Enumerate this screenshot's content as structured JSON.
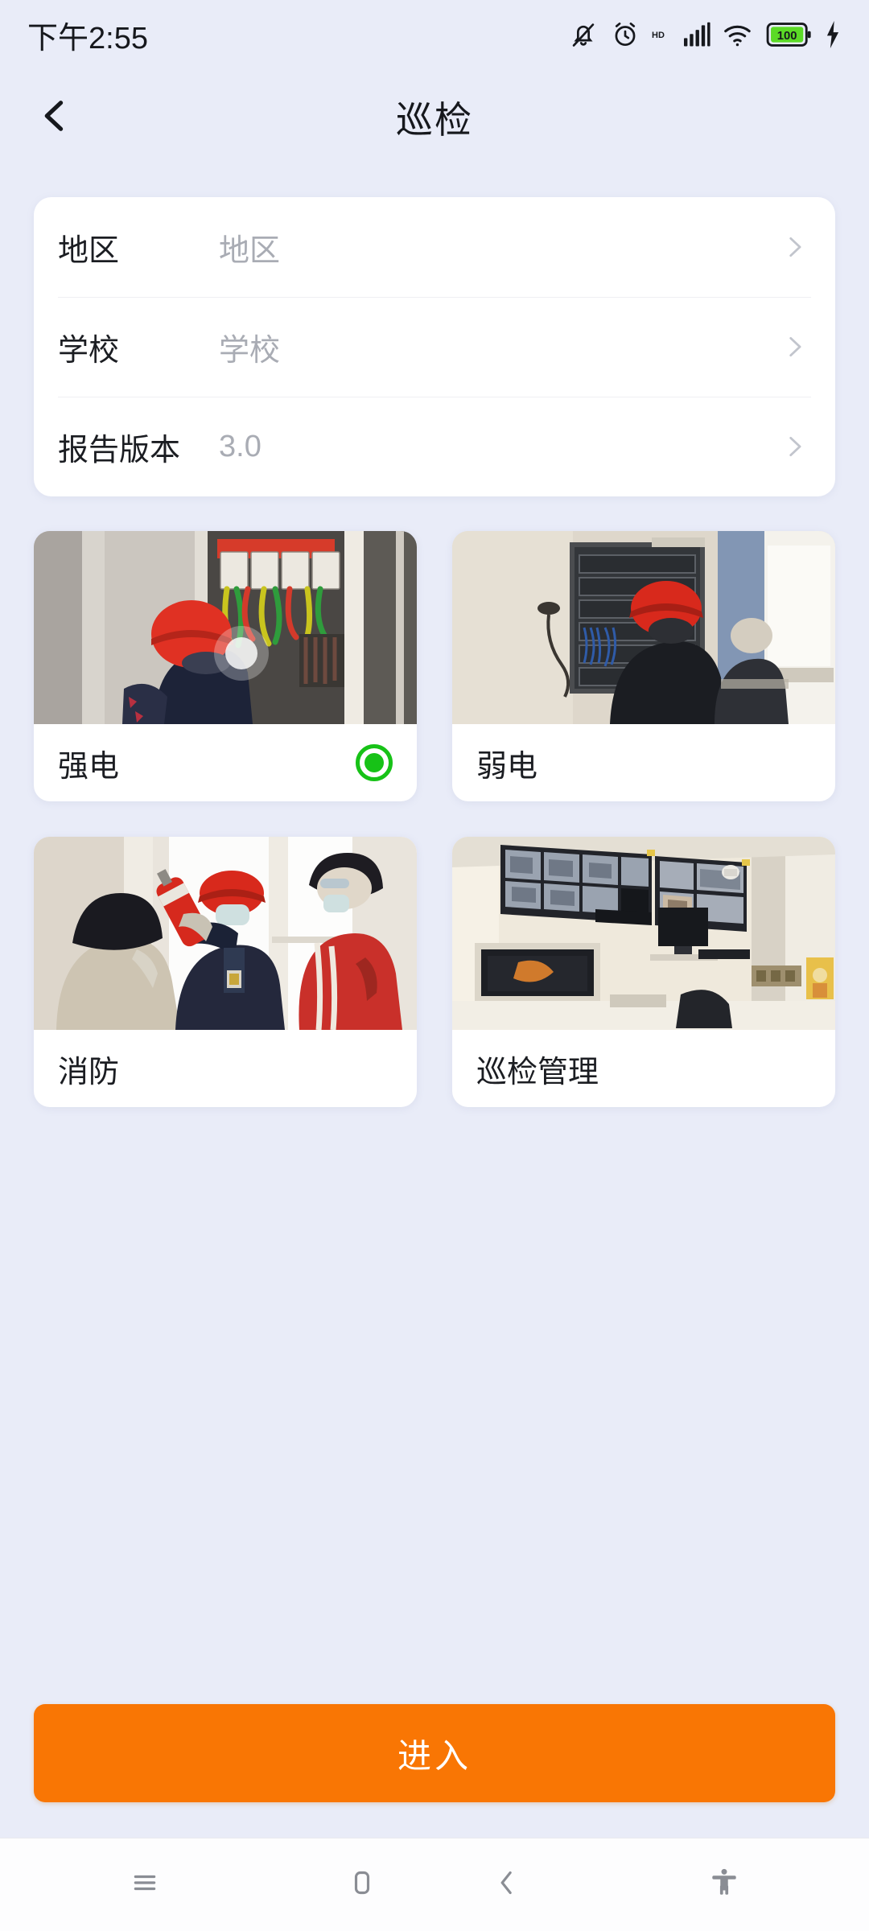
{
  "status_bar": {
    "time": "下午2:55",
    "battery_level": "100",
    "icons": [
      "bell-muted-icon",
      "alarm-icon",
      "hd-icon",
      "signal-icon",
      "wifi-icon",
      "battery-icon",
      "charging-bolt-icon"
    ]
  },
  "header": {
    "title": "巡检",
    "back_icon": "chevron-left-icon"
  },
  "form": {
    "rows": [
      {
        "label": "地区",
        "value": "地区",
        "is_placeholder": true,
        "chevron": "chevron-right-icon"
      },
      {
        "label": "学校",
        "value": "学校",
        "is_placeholder": true,
        "chevron": "chevron-right-icon"
      },
      {
        "label": "报告版本",
        "value": "3.0",
        "is_placeholder": false,
        "chevron": "chevron-right-icon"
      }
    ]
  },
  "tiles": [
    {
      "label": "强电",
      "selected": true,
      "image": "worker-red-helmet-electrical-panel"
    },
    {
      "label": "弱电",
      "selected": false,
      "image": "workers-server-rack-room"
    },
    {
      "label": "消防",
      "selected": false,
      "image": "fire-extinguisher-demonstration"
    },
    {
      "label": "巡检管理",
      "selected": false,
      "image": "cctv-monitoring-room"
    }
  ],
  "primary_action": {
    "label": "进入"
  },
  "nav_bar": {
    "recents_icon": "menu-icon",
    "home_icon": "home-square-icon",
    "back_icon": "chevron-left-icon",
    "accessibility_icon": "accessibility-icon"
  },
  "colors": {
    "background": "#E9ECF8",
    "card": "#FFFFFF",
    "accent_orange": "#F97604",
    "selected_green": "#17C217",
    "text_primary": "#1B1D22",
    "text_placeholder": "#A9ACB4"
  }
}
